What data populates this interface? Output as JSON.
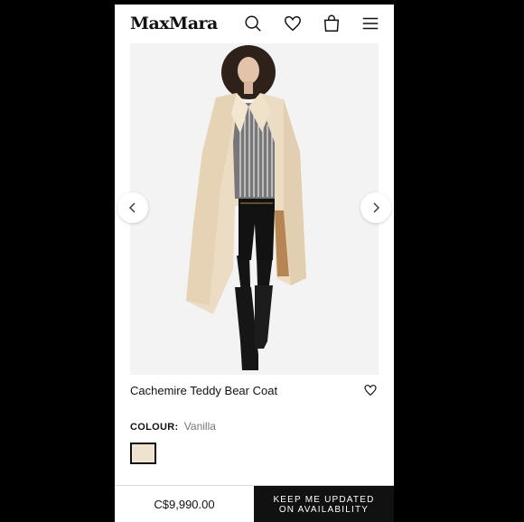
{
  "header": {
    "logo": "MaxMara",
    "icons": [
      "search-icon",
      "heart-icon",
      "shopping-bag-icon",
      "menu-icon"
    ]
  },
  "gallery": {
    "prev_icon": "chevron-left-icon",
    "next_icon": "chevron-right-icon"
  },
  "product": {
    "name": "Cachemire Teddy Bear Coat",
    "wishlist_icon": "heart-icon",
    "colour_label": "COLOUR:",
    "colour_value": "Vanilla",
    "swatch_color": "#efe3cf"
  },
  "footer": {
    "price": "C$9,990.00",
    "cta_line1": "KEEP ME UPDATED",
    "cta_line2": "ON AVAILABILITY"
  }
}
